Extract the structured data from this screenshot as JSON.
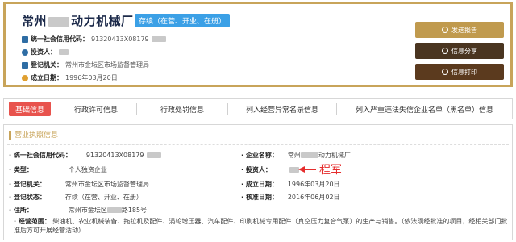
{
  "header": {
    "company_prefix": "常州",
    "company_suffix": "动力机械厂",
    "status": "存续（在营、开业、在册）",
    "credit_code_label": "统一社会信用代码：",
    "credit_code_value": "91320413X08179",
    "investor_label": "投资人：",
    "authority_label": "登记机关：",
    "authority_value": "常州市金坛区市场监督管理局",
    "founded_label": "成立日期：",
    "founded_value": "1996年03月20日"
  },
  "actions": {
    "send_report": "发送报告",
    "share": "信息分享",
    "print": "信息打印"
  },
  "tabs": [
    "基础信息",
    "行政许可信息",
    "行政处罚信息",
    "列入经营异常名录信息",
    "列入严重违法失信企业名单（黑名单）信息"
  ],
  "panel": {
    "section_title": "营业执照信息",
    "credit_code_label": "· 统一社会信用代码：",
    "credit_code_value": "91320413X08179",
    "company_name_label": "· 企业名称：",
    "company_name_prefix": "常州",
    "company_name_suffix": "动力机械厂",
    "type_label": "· 类型：",
    "type_value": "个人独资企业",
    "investor_label": "· 投资人：",
    "authority_label": "· 登记机关：",
    "authority_value": "常州市金坛区市场监督管理局",
    "founded_label": "· 成立日期：",
    "founded_value": "1996年03月20日",
    "reg_status_label": "· 登记状态：",
    "reg_status_value": "存续（在营、开业、在册）",
    "approval_label": "· 核准日期：",
    "approval_value": "2016年06月02日",
    "address_label": "· 住所：",
    "address_prefix": "常州市金坛区",
    "address_suffix": "路185号",
    "scope_label": "· 经营范围：",
    "scope_value": "柴油机、农业机械装备、拖拉机及配件、涡轮增压器、汽车配件、印刷机械专用配件（真空压力复合气泵）的生产与销售。（依法须经批准的项目，经相关部门批准后方可开展经营活动）"
  },
  "annotation": {
    "name": "程军"
  }
}
